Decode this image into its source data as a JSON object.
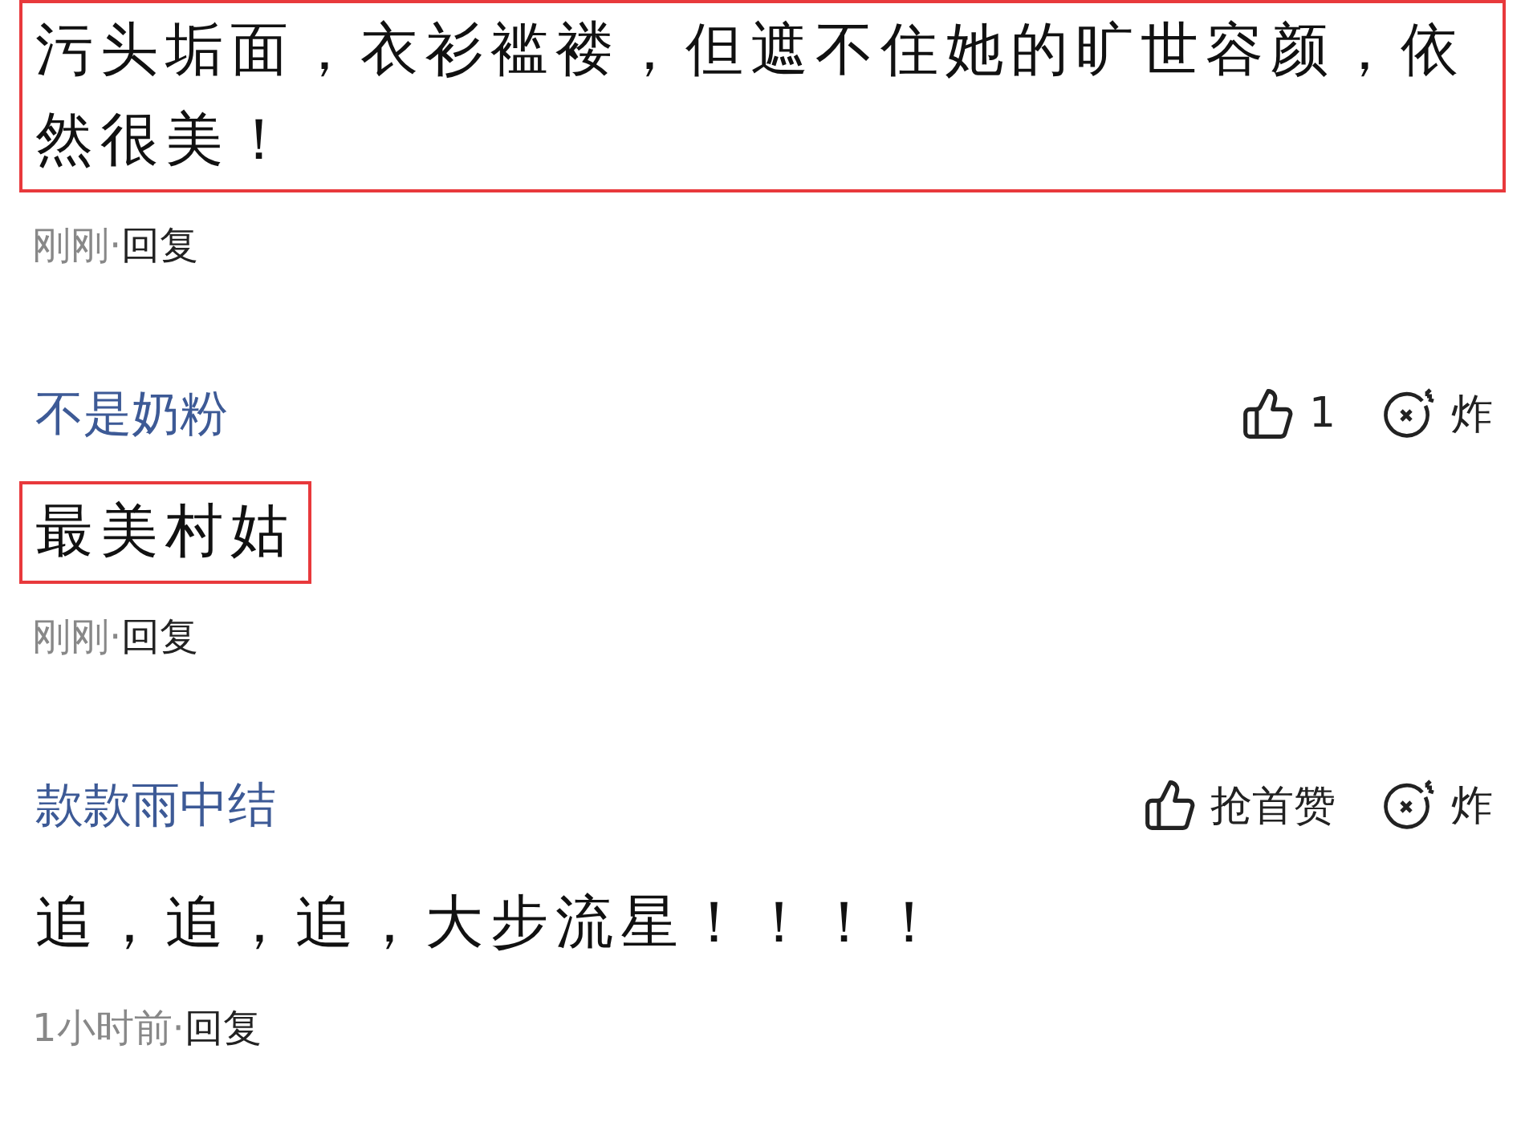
{
  "comments": [
    {
      "text": "污头垢面，衣衫褴褛，但遮不住她的旷世容颜，依然很美！",
      "highlighted": true,
      "time": "刚刚",
      "separator": "·",
      "reply": "回复"
    },
    {
      "author": "不是奶粉",
      "likes": "1",
      "bomb": "炸",
      "text": "最美村姑",
      "highlighted": true,
      "time": "刚刚",
      "separator": "·",
      "reply": "回复"
    },
    {
      "author": "款款雨中结",
      "likes": "抢首赞",
      "bomb": "炸",
      "text": "追，追，追，大步流星！！！！",
      "highlighted": false,
      "time": "1小时前",
      "separator": "·",
      "reply": "回复"
    }
  ]
}
